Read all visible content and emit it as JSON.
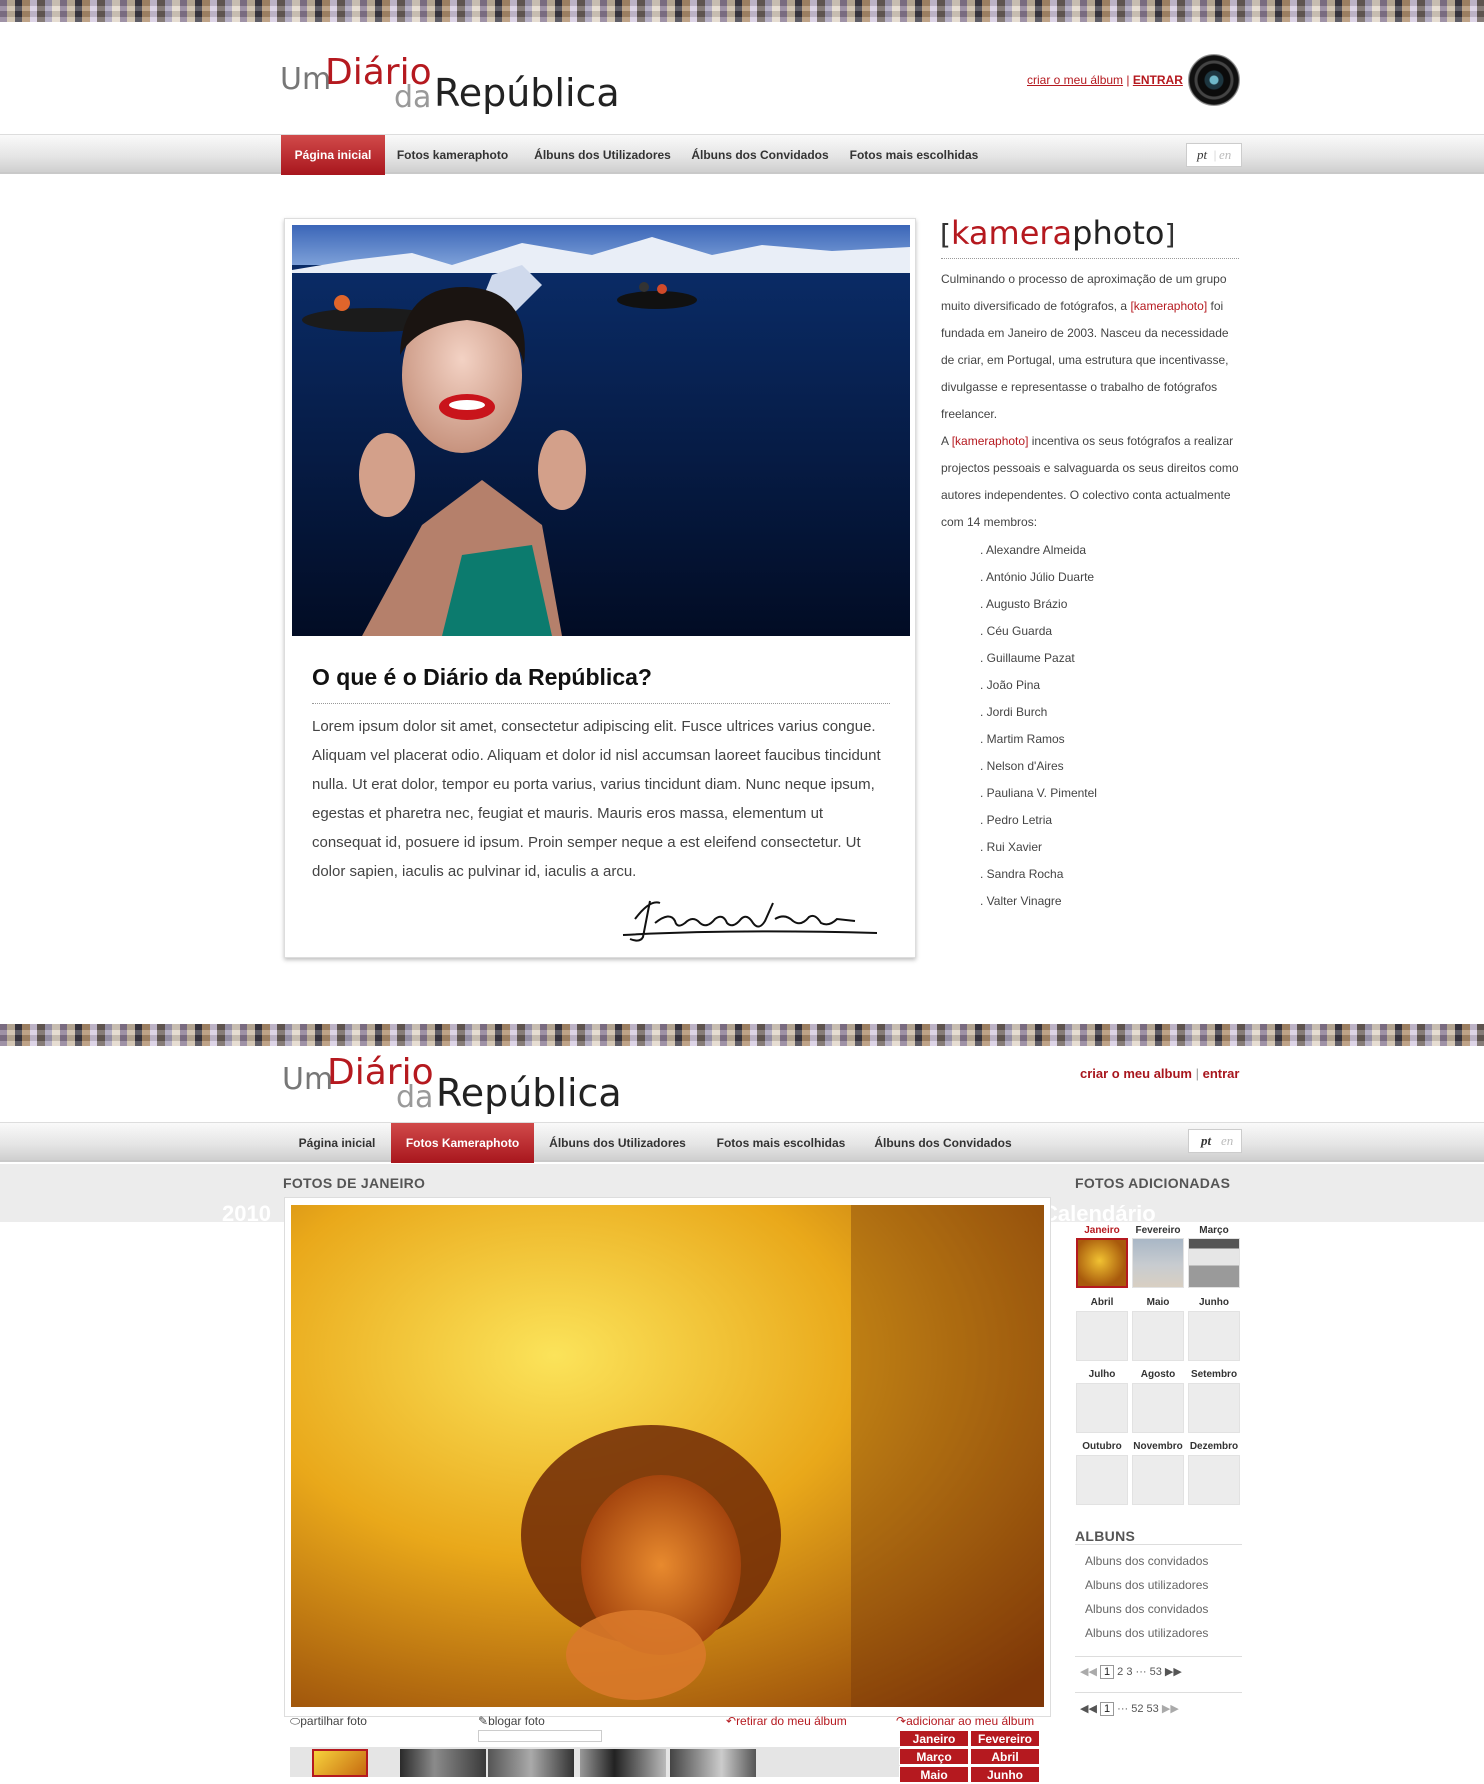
{
  "page1": {
    "header": {
      "logo": {
        "um": "Um",
        "diario": "Diário",
        "da": "da",
        "republica": "República"
      },
      "create_album": "criar o meu álbum",
      "separator": "|",
      "login": "ENTRAR"
    },
    "nav": {
      "items": [
        "Página inicial",
        "Fotos kameraphoto",
        "Álbuns dos Utilizadores",
        "Álbuns dos Convidados",
        "Fotos mais escolhidas"
      ],
      "active_index": 0,
      "lang_pt": "pt",
      "lang_sep": "|",
      "lang_en": "en"
    },
    "main": {
      "title": "O que é o Diário da República?",
      "body": "Lorem ipsum dolor sit amet, consectetur adipiscing elit. Fusce ultrices varius congue. Aliquam vel placerat odio. Aliquam et dolor id nisl accumsan laoreet faucibus tincidunt nulla. Ut erat dolor, tempor eu porta varius, varius tincidunt diam. Nunc neque ipsum, egestas et pharetra nec, feugiat et mauris. Mauris eros massa, elementum ut consequat id, posuere id ipsum. Proin semper neque a est eleifend consectetur. Ut dolor sapien, iaculis ac pulvinar id, iaculis a arcu."
    },
    "sidebar": {
      "title_open": "[",
      "title_red": "kamera",
      "title_rest": "photo",
      "title_close": "]",
      "p1_a": "Culminando o processo de aproximação de um grupo muito diversificado de fotógrafos, a ",
      "brand": "[kameraphoto]",
      "p1_b": " foi fundada em Janeiro de 2003. Nasceu da necessidade de criar, em Portugal, uma estrutura que incentivasse, divulgasse e representasse o trabalho de fotógrafos freelancer.",
      "p2_a": "A ",
      "p2_b": " incentiva os seus fotógrafos a realizar projectos pessoais e salvaguarda os seus direitos como autores independentes. O colectivo conta actualmente com 14 membros:",
      "members": [
        ". Alexandre Almeida",
        ". António Júlio Duarte",
        ". Augusto Brázio",
        ". Céu Guarda",
        ". Guillaume Pazat",
        ". João Pina",
        ". Jordi Burch",
        ". Martim Ramos",
        ". Nelson d'Aires",
        ". Pauliana V. Pimentel",
        ". Pedro Letria",
        ". Rui Xavier",
        ". Sandra Rocha",
        ". Valter Vinagre"
      ]
    }
  },
  "page2": {
    "header": {
      "create_album": "criar o meu album",
      "separator": "|",
      "login": "entrar"
    },
    "nav": {
      "items": [
        "Página inicial",
        "Fotos Kameraphoto",
        "Álbuns dos Utilizadores",
        "Fotos mais escolhidas",
        "Álbuns dos Convidados"
      ],
      "active_index": 1,
      "lang_pt": "pt",
      "lang_en": "en"
    },
    "main": {
      "section_title": "FOTOS DE JANEIRO",
      "ghost_left": "2010",
      "ghost_right": "Calendário",
      "actions": {
        "share": "partilhar foto",
        "blog": "blogar foto",
        "remove": "retirar do meu álbum",
        "add": "adicionar ao meu álbum"
      },
      "month_buttons": [
        "Janeiro",
        "Fevereiro",
        "Março",
        "Abril",
        "Maio",
        "Junho"
      ]
    },
    "sidebar": {
      "section_title": "FOTOS ADICIONADAS",
      "months": [
        "Janeiro",
        "Fevereiro",
        "Março",
        "Abril",
        "Maio",
        "Junho",
        "Julho",
        "Agosto",
        "Setembro",
        "Outubro",
        "Novembro",
        "Dezembro"
      ],
      "selected_month": "Janeiro",
      "albums_title": "ALBUNS",
      "albums": [
        "Albuns dos convidados",
        "Albuns dos utilizadores",
        "Albuns dos convidados",
        "Albuns dos utilizadores"
      ],
      "pager1": {
        "current": "1",
        "p2": "2",
        "p3": "3",
        "ellipsis": "···",
        "last": "53"
      },
      "pager2": {
        "current": "1",
        "ellipsis": "···",
        "p52": "52",
        "last": "53"
      }
    }
  },
  "colors": {
    "brand_red": "#b5191f",
    "text": "#333333",
    "band": "#ececec"
  }
}
